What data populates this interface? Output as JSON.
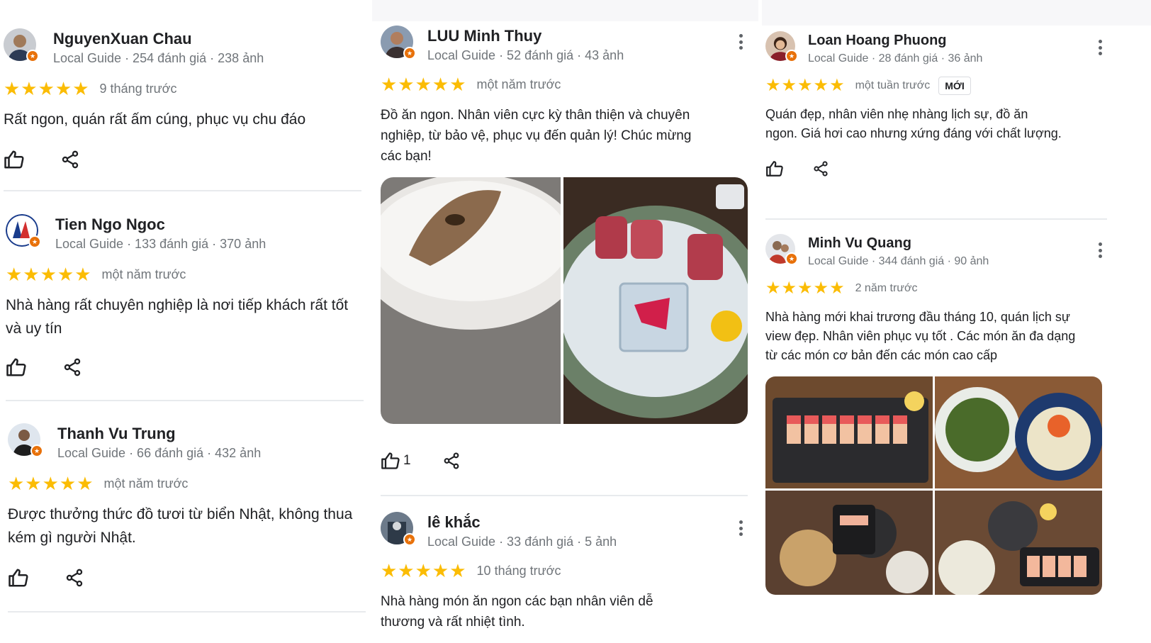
{
  "colors": {
    "star": "#fbbc04",
    "badge": "#e8710a",
    "meta": "#70757a"
  },
  "reviews": {
    "r1": {
      "name": "NguyenXuan Chau",
      "meta": "Local Guide · 254 đánh giá · 238 ảnh",
      "stars": "★★★★★",
      "time": "9 tháng trước",
      "text": "Rất ngon, quán rất ấm cúng, phục vụ chu đáo"
    },
    "r2": {
      "name": "Tien Ngo Ngoc",
      "meta": "Local Guide · 133 đánh giá · 370 ảnh",
      "stars": "★★★★★",
      "time": "một năm trước",
      "text": "Nhà hàng rất chuyên nghiệp là nơi tiếp khách rất tốt và uy tín"
    },
    "r3": {
      "name": "Thanh Vu Trung",
      "meta": "Local Guide · 66 đánh giá · 432 ảnh",
      "stars": "★★★★★",
      "time": "một năm trước",
      "text": "Được thưởng thức đồ tươi từ biển Nhật, không thua kém gì người Nhật."
    },
    "r4": {
      "name": "LUU Minh Thuy",
      "meta": "Local Guide · 52 đánh giá · 43 ảnh",
      "stars": "★★★★★",
      "time": "một năm trước",
      "text": "Đồ ăn ngon. Nhân viên cực kỳ thân thiện và chuyên nghiệp, từ bảo vệ, phục vụ đến quản lý! Chúc mừng các bạn!",
      "likes": "1"
    },
    "r5": {
      "name": "lê khắc",
      "meta": "Local Guide · 33 đánh giá · 5 ảnh",
      "stars": "★★★★★",
      "time": "10 tháng trước",
      "text": "Nhà hàng món ăn ngon các bạn nhân viên dễ thương và rất nhiệt tình."
    },
    "r6": {
      "name": "Loan Hoang Phuong",
      "meta": "Local Guide · 28 đánh giá · 36 ảnh",
      "stars": "★★★★★",
      "time": "một tuần trước",
      "badge": "MỚI",
      "text": "Quán đẹp, nhân viên nhẹ nhàng lịch sự, đồ ăn ngon. Giá hơi cao nhưng xứng đáng với chất lượng."
    },
    "r7": {
      "name": "Minh Vu Quang",
      "meta": "Local Guide · 344 đánh giá · 90 ảnh",
      "stars": "★★★★★",
      "time": "2 năm trước",
      "text": "Nhà hàng mới khai trương đầu tháng 10, quán lịch sự view đẹp. Nhân viên phục vụ tốt . Các món ăn đa dạng từ các món cơ bản đến các món cao cấp"
    }
  },
  "icons": {
    "like": "thumbs-up-icon",
    "share": "share-icon",
    "more": "more-vert-icon",
    "local_guide": "local-guide-star-icon"
  }
}
